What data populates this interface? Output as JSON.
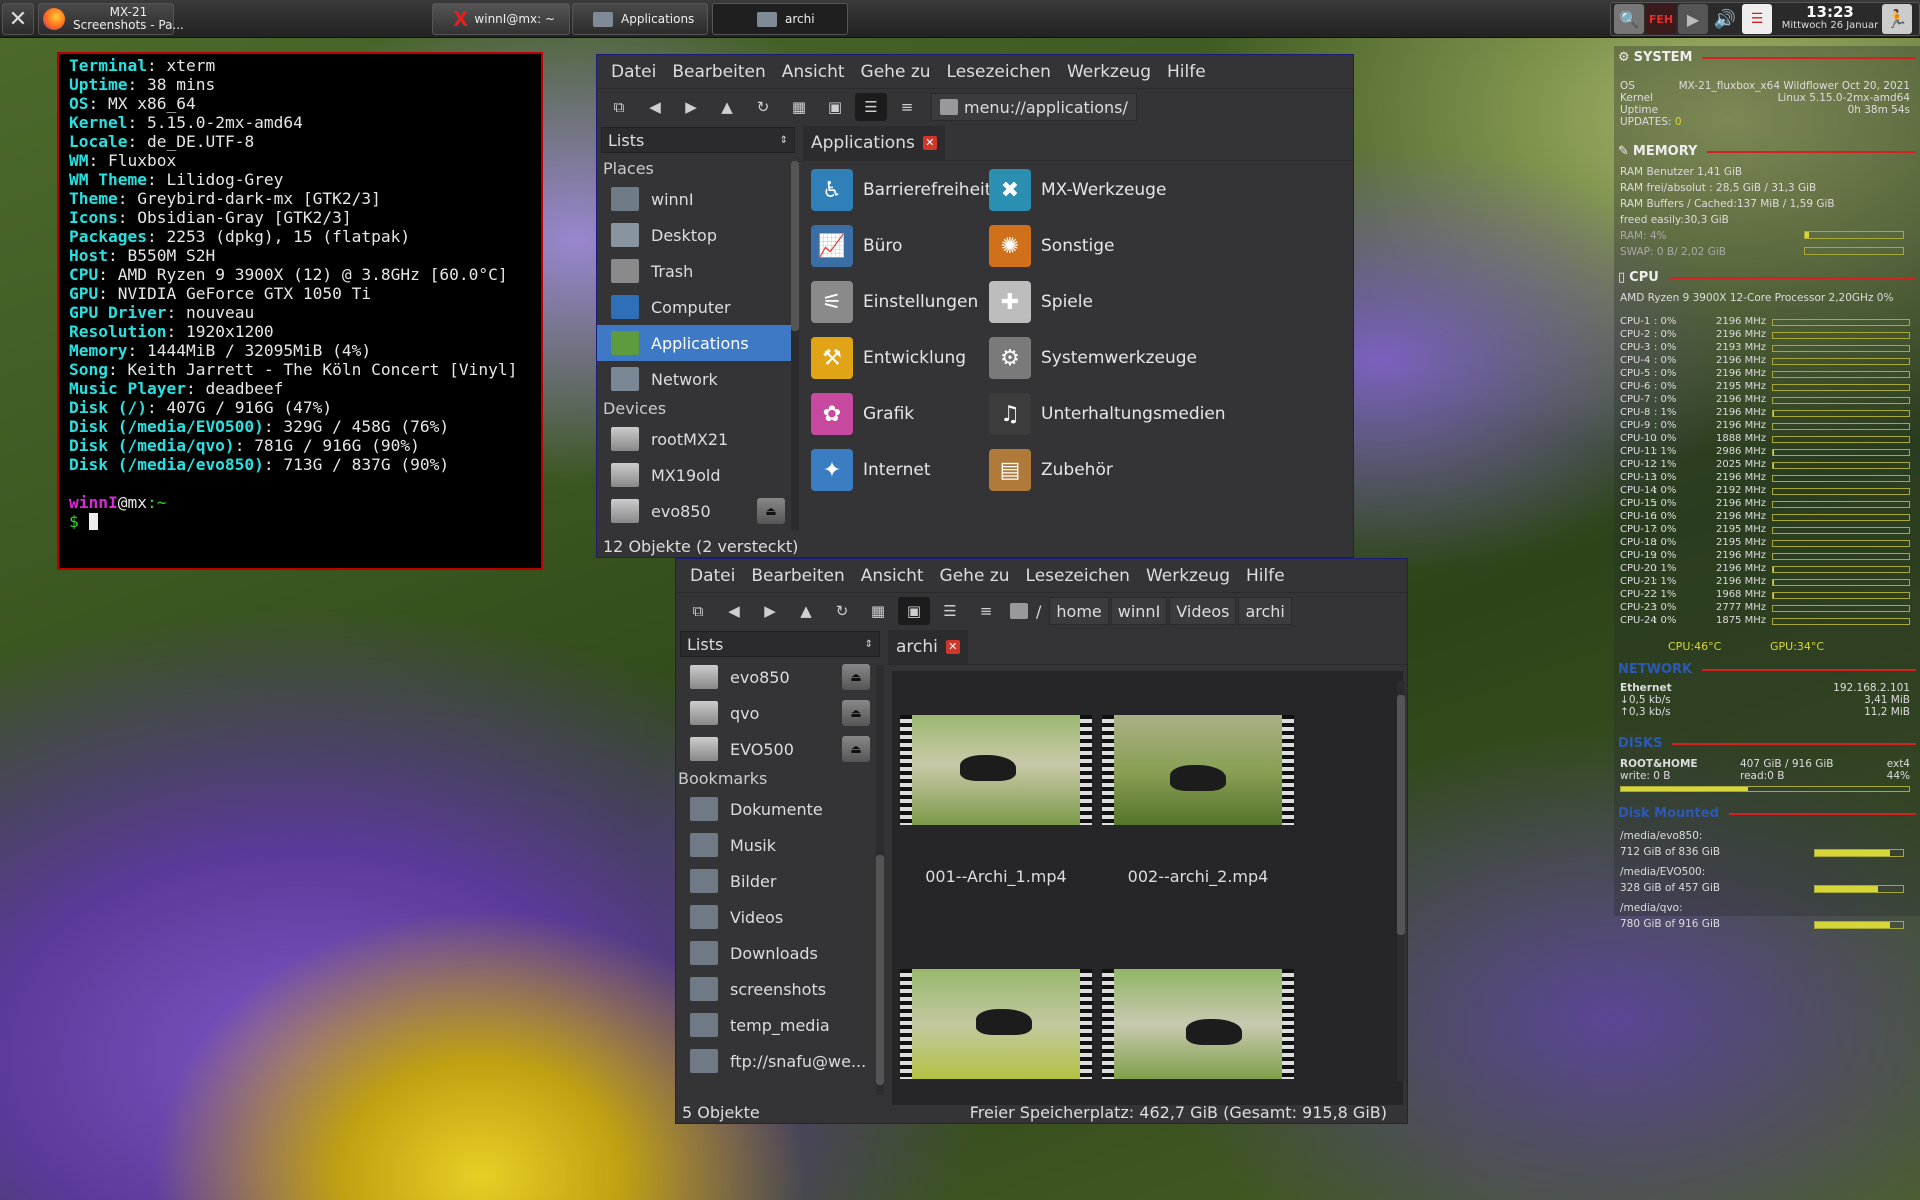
{
  "taskbar": {
    "firefox_title": "MX-21",
    "firefox_sub": "Screenshots - Pa...",
    "tasks": [
      {
        "label": "winnI@mx: ~"
      },
      {
        "label": "Applications"
      },
      {
        "label": "archi"
      }
    ],
    "tray_feh": "FEH",
    "clock_time": "13:23",
    "clock_date": "Mittwoch 26 Januar"
  },
  "terminal": {
    "lines": [
      {
        "k": "Terminal",
        "v": "xterm"
      },
      {
        "k": "Uptime",
        "v": "38 mins"
      },
      {
        "k": "OS",
        "v": "MX x86_64"
      },
      {
        "k": "Kernel",
        "v": "5.15.0-2mx-amd64"
      },
      {
        "k": "Locale",
        "v": "de_DE.UTF-8"
      },
      {
        "k": "WM",
        "v": "Fluxbox"
      },
      {
        "k": "WM Theme",
        "v": "Lilidog-Grey"
      },
      {
        "k": "Theme",
        "v": "Greybird-dark-mx [GTK2/3]"
      },
      {
        "k": "Icons",
        "v": "Obsidian-Gray [GTK2/3]"
      },
      {
        "k": "Packages",
        "v": "2253 (dpkg), 15 (flatpak)"
      },
      {
        "k": "Host",
        "v": "B550M S2H"
      },
      {
        "k": "CPU",
        "v": "AMD Ryzen 9 3900X (12) @ 3.8GHz [60.0°C]"
      },
      {
        "k": "GPU",
        "v": "NVIDIA GeForce GTX 1050 Ti"
      },
      {
        "k": "GPU Driver",
        "v": "nouveau"
      },
      {
        "k": "Resolution",
        "v": "1920x1200"
      },
      {
        "k": "Memory",
        "v": "1444MiB / 32095MiB (4%)"
      },
      {
        "k": "Song",
        "v": "Keith Jarrett - The Köln Concert [Vinyl]"
      },
      {
        "k": "Music Player",
        "v": "deadbeef"
      },
      {
        "k": "Disk (/)",
        "v": "407G / 916G (47%)"
      },
      {
        "k": "Disk (/media/EVO500)",
        "v": "329G / 458G (76%)"
      },
      {
        "k": "Disk (/media/qvo)",
        "v": "781G / 916G (90%)"
      },
      {
        "k": "Disk (/media/evo850)",
        "v": "713G / 837G (90%)"
      }
    ],
    "prompt_user": "winnI",
    "prompt_host": "@mx",
    "prompt_path": ":~",
    "prompt_sym": "$"
  },
  "fm1": {
    "menu": [
      "Datei",
      "Bearbeiten",
      "Ansicht",
      "Gehe zu",
      "Lesezeichen",
      "Werkzeug",
      "Hilfe"
    ],
    "location": "menu://applications/",
    "sidebar_head": "Lists",
    "places_title": "Places",
    "places": [
      {
        "label": "winnI",
        "icon": "home-folder-icon"
      },
      {
        "label": "Desktop",
        "icon": "desktop-icon"
      },
      {
        "label": "Trash",
        "icon": "trash-icon"
      },
      {
        "label": "Computer",
        "icon": "computer-icon"
      },
      {
        "label": "Applications",
        "icon": "applications-icon"
      },
      {
        "label": "Network",
        "icon": "network-icon"
      }
    ],
    "devices_title": "Devices",
    "devices": [
      {
        "label": "rootMX21"
      },
      {
        "label": "MX19old"
      },
      {
        "label": "evo850"
      }
    ],
    "tab": "Applications",
    "apps_left": [
      {
        "label": "Barrierefreiheit",
        "icon": "accessibility-icon",
        "color": "#2f7fb8"
      },
      {
        "label": "Büro",
        "icon": "office-chart-icon",
        "color": "#3a6ea5"
      },
      {
        "label": "Einstellungen",
        "icon": "settings-sliders-icon",
        "color": "#8a8a8a"
      },
      {
        "label": "Entwicklung",
        "icon": "construction-icon",
        "color": "#e0a416"
      },
      {
        "label": "Grafik",
        "icon": "graphics-palette-icon",
        "color": "#c84aa0"
      },
      {
        "label": "Internet",
        "icon": "internet-globe-icon",
        "color": "#3b7dc2"
      }
    ],
    "apps_right": [
      {
        "label": "MX-Werkzeuge",
        "icon": "mx-tools-icon",
        "color": "#2a8fb0"
      },
      {
        "label": "Sonstige",
        "icon": "other-icon",
        "color": "#d0701a"
      },
      {
        "label": "Spiele",
        "icon": "gamepad-icon",
        "color": "#bdbdbd"
      },
      {
        "label": "Systemwerkzeuge",
        "icon": "system-gears-icon",
        "color": "#7a7a7a"
      },
      {
        "label": "Unterhaltungsmedien",
        "icon": "multimedia-icon",
        "color": "#3c3c3c"
      },
      {
        "label": "Zubehör",
        "icon": "calculator-icon",
        "color": "#b07a3a"
      }
    ],
    "status": "12 Objekte (2 versteckt)"
  },
  "fm2": {
    "menu": [
      "Datei",
      "Bearbeiten",
      "Ansicht",
      "Gehe zu",
      "Lesezeichen",
      "Werkzeug",
      "Hilfe"
    ],
    "path": [
      "/",
      "home",
      "winnI",
      "Videos",
      "archi"
    ],
    "sidebar_head": "Lists",
    "devices": [
      {
        "label": "evo850"
      },
      {
        "label": "qvo"
      },
      {
        "label": "EVO500"
      }
    ],
    "bookmarks_title": "Bookmarks",
    "bookmarks": [
      {
        "label": "Dokumente"
      },
      {
        "label": "Musik"
      },
      {
        "label": "Bilder"
      },
      {
        "label": "Videos"
      },
      {
        "label": "Downloads"
      },
      {
        "label": "screenshots"
      },
      {
        "label": "temp_media"
      },
      {
        "label": "ftp://snafu@we..."
      }
    ],
    "tab": "archi",
    "files": [
      {
        "label": "001--Archi_1.mp4"
      },
      {
        "label": "002--archi_2.mp4"
      },
      {
        "label": ""
      },
      {
        "label": ""
      }
    ],
    "status_left": "5 Objekte",
    "status_right": "Freier Speicherplatz: 462,7  GiB (Gesamt: 915,8  GiB)"
  },
  "conky": {
    "system_title": "SYSTEM",
    "os_k": "OS",
    "os_v": "MX-21_fluxbox_x64 Wildflower Oct 20, 2021",
    "kernel_k": "Kernel",
    "kernel_v": "Linux 5.15.0-2mx-amd64",
    "uptime_k": "Uptime",
    "uptime_v": "0h 38m 54s",
    "updates_k": "UPDATES:",
    "updates_v": "0",
    "memory_title": "MEMORY",
    "mem1": "RAM Benutzer 1,41 GiB",
    "mem2": "RAM frei/absolut : 28,5 GiB / 31,3 GiB",
    "mem3": "RAM Buffers / Cached:137 MiB / 1,59 GiB",
    "mem4": "freed easily:30,3 GiB",
    "ram_lbl": "RAM: 4%",
    "ram_pct": 4,
    "swap_lbl": "SWAP: 0 B/ 2,02 GiB",
    "swap_pct": 0,
    "cpu_title": "CPU",
    "cpu_model": "AMD Ryzen 9 3900X 12-Core Processor 2,20GHz  0%",
    "cores": [
      {
        "n": "CPU-1",
        "p": ": 0%",
        "m": "2196 MHz",
        "load": 0
      },
      {
        "n": "CPU-2",
        "p": ": 0%",
        "m": "2196 MHz",
        "load": 0
      },
      {
        "n": "CPU-3",
        "p": ": 0%",
        "m": "2193 MHz",
        "load": 0
      },
      {
        "n": "CPU-4",
        "p": ": 0%",
        "m": "2196 MHz",
        "load": 0
      },
      {
        "n": "CPU-5",
        "p": ": 0%",
        "m": "2196 MHz",
        "load": 0
      },
      {
        "n": "CPU-6",
        "p": ": 0%",
        "m": "2195 MHz",
        "load": 0
      },
      {
        "n": "CPU-7",
        "p": ": 0%",
        "m": "2196 MHz",
        "load": 0
      },
      {
        "n": "CPU-8",
        "p": ": 1%",
        "m": "2196 MHz",
        "load": 1
      },
      {
        "n": "CPU-9",
        "p": ": 0%",
        "m": "2196 MHz",
        "load": 0
      },
      {
        "n": "CPU-10",
        "p": ": 0%",
        "m": "1888 MHz",
        "load": 0
      },
      {
        "n": "CPU-11",
        "p": ": 1%",
        "m": "2986 MHz",
        "load": 1
      },
      {
        "n": "CPU-12",
        "p": ": 1%",
        "m": "2025 MHz",
        "load": 1
      },
      {
        "n": "CPU-13",
        "p": ": 0%",
        "m": "2196 MHz",
        "load": 0
      },
      {
        "n": "CPU-14",
        "p": ": 0%",
        "m": "2192 MHz",
        "load": 0
      },
      {
        "n": "CPU-15",
        "p": ": 0%",
        "m": "2196 MHz",
        "load": 0
      },
      {
        "n": "CPU-16",
        "p": ": 0%",
        "m": "2196 MHz",
        "load": 0
      },
      {
        "n": "CPU-17",
        "p": ": 0%",
        "m": "2195 MHz",
        "load": 0
      },
      {
        "n": "CPU-18",
        "p": ": 0%",
        "m": "2195 MHz",
        "load": 0
      },
      {
        "n": "CPU-19",
        "p": ": 0%",
        "m": "2196 MHz",
        "load": 0
      },
      {
        "n": "CPU-20",
        "p": ": 1%",
        "m": "2196 MHz",
        "load": 1
      },
      {
        "n": "CPU-21",
        "p": ": 1%",
        "m": "2196 MHz",
        "load": 1
      },
      {
        "n": "CPU-22",
        "p": ": 1%",
        "m": "1968 MHz",
        "load": 1
      },
      {
        "n": "CPU-23",
        "p": ": 0%",
        "m": "2777 MHz",
        "load": 0
      },
      {
        "n": "CPU-24",
        "p": ": 0%",
        "m": "1875 MHz",
        "load": 0
      }
    ],
    "cpu_temp": "CPU:46°C",
    "gpu_temp": "GPU:34°C",
    "network_title": "NETWORK",
    "eth_k": "Ethernet",
    "eth_v": "192.168.2.101",
    "down": "0,5 kb/s",
    "down_total": "3,41 MiB",
    "up": "0,3 kb/s",
    "up_total": "11,2 MiB",
    "disks_title": "DISKS",
    "root_k": "ROOT&HOME",
    "root_v": "407 GiB / 916 GiB",
    "root_fs": "ext4",
    "write": "write: 0 B",
    "read": "read:0 B",
    "root_pct_lbl": "44%",
    "root_pct": 44,
    "mounted_title": "Disk Mounted",
    "mounts": [
      {
        "path": "/media/evo850:",
        "size": "712 GiB of 836 GiB",
        "pct": 85
      },
      {
        "path": "/media/EVO500:",
        "size": "328 GiB of 457 GiB",
        "pct": 72
      },
      {
        "path": "/media/qvo:",
        "size": "780 GiB of 916 GiB",
        "pct": 85
      }
    ]
  }
}
